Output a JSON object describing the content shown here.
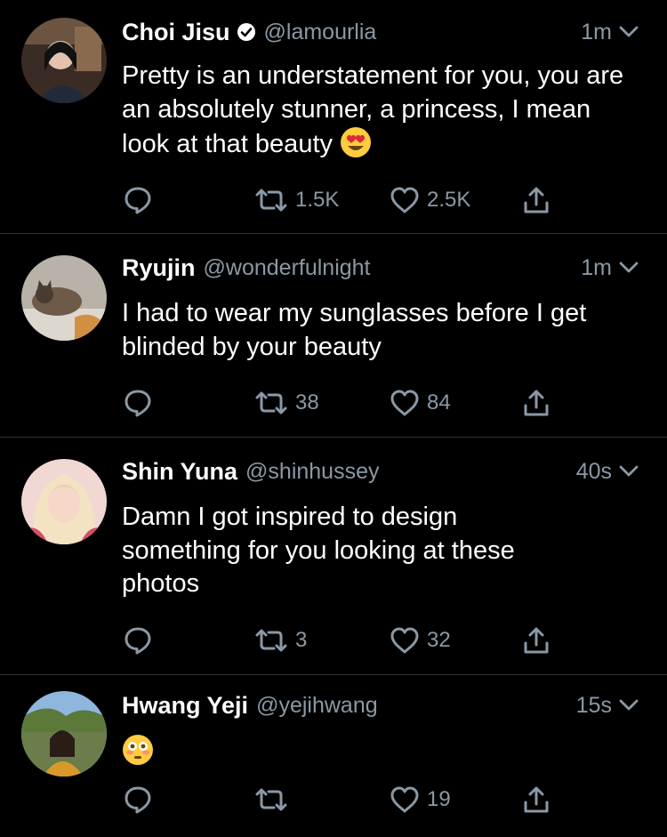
{
  "colors": {
    "background": "#000000",
    "text": "#ffffff",
    "secondary": "#8b98a5",
    "divider": "#2f3336"
  },
  "tweets": [
    {
      "name": "Choi Jisu",
      "verified": true,
      "handle": "@lamourlia",
      "time": "1m",
      "text": "Pretty is an understatement for you, you are an absolutely stunner, a princess, I mean look at that beauty",
      "emoji": "heart-eyes-emoji",
      "replies": "",
      "retweets": "1.5K",
      "likes": "2.5K"
    },
    {
      "name": "Ryujin",
      "verified": false,
      "handle": "@wonderfulnight",
      "time": "1m",
      "text": "I had to wear my sunglasses before I get blinded by your beauty",
      "replies": "",
      "retweets": "38",
      "likes": "84"
    },
    {
      "name": "Shin Yuna",
      "verified": false,
      "handle": "@shinhussey",
      "time": "40s",
      "text": "Damn I got inspired to design something for you looking at these photos",
      "replies": "",
      "retweets": "3",
      "likes": "32"
    },
    {
      "name": "Hwang Yeji",
      "verified": false,
      "handle": "@yejihwang",
      "time": "15s",
      "text": "",
      "emoji": "flushed-face-emoji",
      "replies": "",
      "retweets": "",
      "likes": "19"
    }
  ]
}
